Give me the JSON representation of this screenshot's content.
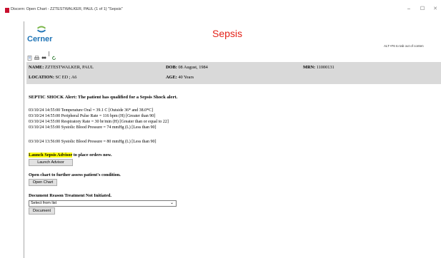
{
  "window": {
    "title": "Discern: Open Chart - ZZTESTWALKER, PAUL (1 of 1) \"Sepsis\"",
    "controls": {
      "minimize": "–",
      "maximize": "☐",
      "close": "✕"
    }
  },
  "header": {
    "logo_text": "Cerner",
    "title": "Sepsis",
    "hint": "ALT+F6 to tab out of conten"
  },
  "toolbar": {
    "icons": [
      "print-preview-icon",
      "print-icon",
      "find-icon",
      "refresh-icon"
    ]
  },
  "patient": {
    "name_label": "NAME:",
    "name_value": "ZZTESTWALKER, PAUL",
    "dob_label": "DOB:",
    "dob_value": "08 August, 1984",
    "mrn_label": "MRN:",
    "mrn_value": "11000131",
    "location_label": "LOCATION:",
    "location_value": "SC ED ; A6",
    "age_label": "AGE:",
    "age_value": "40 Years"
  },
  "alert": {
    "heading": "SEPTIC SHOCK Alert: The patient has qualified for a Sepsis Shock alert.",
    "vitals": [
      "03/10/24 14:55:00 Temperature Oral = 39.1 C [Outside 36* and 38.0*C]",
      "03/10/24 14:55:00 Peripheral Pulse Rate = 116 bpm (H) [Greater than 90]",
      "03/10/24 14:55:00 Respiratory Rate = 30 br/min (H) [Greater than or equal to 22]",
      "03/10/24 14:55:00 Systolic Blood Pressure = 74 mmHg (L) [Less than 90]"
    ],
    "vital_extra": "03/10/24 13:56:00 Systolic Blood Pressure = 80 mmHg (L) [Less than 90]"
  },
  "actions": {
    "launch_highlight": "Launch Sepsis Advisor",
    "launch_rest": " to place orders now.",
    "launch_button": "Launch Advisor",
    "open_chart_text": "Open chart to further assess patient's condition.",
    "open_chart_button": "Open Chart",
    "document_heading": "Document Reason Treatment Not Initiated.",
    "select_value": "Select from list",
    "document_button": "Document"
  },
  "colors": {
    "brand_blue": "#1f74b6",
    "brand_green": "#7ab648",
    "title_red": "#e32219",
    "highlight": "#ffff00",
    "info_bg": "#d9d9d9"
  }
}
